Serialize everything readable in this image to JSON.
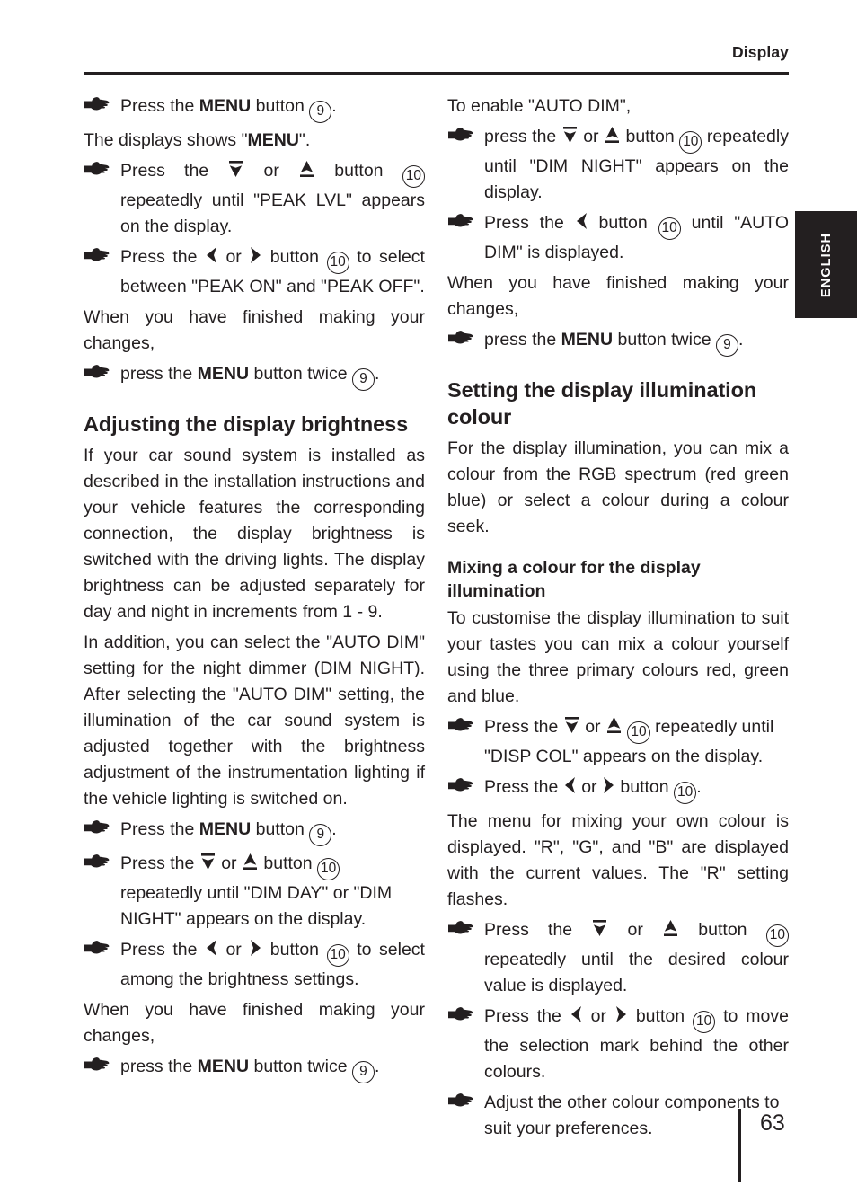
{
  "header": {
    "title": "Display"
  },
  "lang_tab": {
    "label": "ENGLISH"
  },
  "footer": {
    "page_number": "63"
  },
  "icons": {
    "bullet": "pointing-hand-icon",
    "up_key": "up-arrow-key-icon",
    "down_key": "down-arrow-key-icon",
    "left_key": "left-arrow-key-icon",
    "right_key": "right-arrow-key-icon"
  },
  "refs": {
    "menu_button": "9",
    "arrow_buttons": "10"
  },
  "left_column": {
    "b1_a": "Press the ",
    "b1_menu": "MENU",
    "b1_b": " button ",
    "b1_c": ".",
    "p1_a": "The displays shows \"",
    "p1_menu": "MENU",
    "p1_b": "\".",
    "b2_a": "Press the ",
    "b2_or": " or ",
    "b2_b": " button ",
    "b2_c": " repeatedly until \"PEAK LVL\" appears on the display.",
    "b3_a": "Press the ",
    "b3_or": " or ",
    "b3_b": " button ",
    "b3_c": " to select between \"PEAK ON\" and \"PEAK OFF\".",
    "p2": "When you have finished making your changes,",
    "b4_a": "press the ",
    "b4_menu": "MENU",
    "b4_b": " button twice ",
    "b4_c": ".",
    "heading1": "Adjusting the display brightness",
    "p3": "If your car sound system is installed as described in the installation instructions and your vehicle features the corresponding connection, the display brightness is switched with the driving lights. The display brightness can be adjusted separately for day and night in increments from 1 - 9.",
    "p4": "In addition, you can select the \"AUTO DIM\" setting for the night dimmer (DIM NIGHT). After selecting the \"AUTO DIM\" setting, the illumination of the car sound system is adjusted together with the brightness adjustment of the instrumentation lighting if the vehicle lighting is switched on.",
    "b5_a": "Press the ",
    "b5_menu": "MENU",
    "b5_b": " button ",
    "b5_c": ".",
    "b6_a": "Press the ",
    "b6_or": " or ",
    "b6_b": " button ",
    "b6_c": " repeatedly until \"DIM DAY\" or \"DIM NIGHT\" appears on the display.",
    "b7_a": "Press the ",
    "b7_or": " or ",
    "b7_b": " button ",
    "b7_c": " to select among the brightness settings.",
    "p5": "When you have finished making your changes,",
    "b8_a": "press the ",
    "b8_menu": "MENU",
    "b8_b": " button twice ",
    "b8_c": "."
  },
  "right_column": {
    "p1": "To enable \"AUTO DIM\",",
    "b1_a": "press the ",
    "b1_or": " or ",
    "b1_b": " button ",
    "b1_c": " repeatedly until \"DIM NIGHT\" appears on the display.",
    "b2_a": "Press the ",
    "b2_b": " button ",
    "b2_c": " until \"AUTO DIM\" is displayed.",
    "p2": "When you have finished making your changes,",
    "b3_a": "press the ",
    "b3_menu": "MENU",
    "b3_b": " button twice ",
    "b3_c": ".",
    "heading1": "Setting the display illumination colour",
    "p3": "For the display illumination, you can mix a colour from the RGB spectrum (red green blue) or select a colour during a colour seek.",
    "heading2": "Mixing a colour for the display illumination",
    "p4": "To customise the display illumination to suit your tastes you can mix a colour yourself using the three primary colours red, green and blue.",
    "b4_a": "Press the ",
    "b4_or": " or ",
    "b4_b": " ",
    "b4_c": " repeatedly until \"DISP COL\" appears on the display.",
    "b5_a": "Press the ",
    "b5_or": " or ",
    "b5_b": " button ",
    "b5_c": ".",
    "p5": "The menu for mixing your own colour is displayed. \"R\", \"G\", and \"B\" are displayed with the current values. The \"R\" setting flashes.",
    "b6_a": "Press the ",
    "b6_or": " or ",
    "b6_b": " button ",
    "b6_c": " repeatedly until the desired colour value is displayed.",
    "b7_a": "Press the ",
    "b7_or": " or ",
    "b7_b": " button ",
    "b7_c": " to move the selection mark behind the other colours.",
    "b8": "Adjust the other colour components to suit your preferences."
  }
}
